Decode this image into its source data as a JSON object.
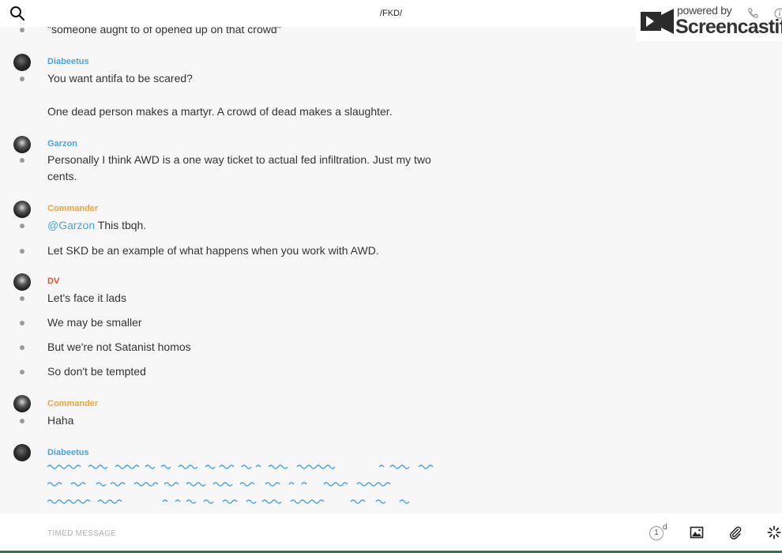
{
  "header": {
    "channel_title": "/FKD/"
  },
  "watermark": {
    "powered_by": "powered by",
    "brand": "Screencastify"
  },
  "messages": {
    "m0": {
      "text": "\"someone aught to of opened up on that crowd\""
    },
    "m1": {
      "user": "Diabeetus",
      "lines": [
        "You want antifa to be scared?",
        "One dead person makes a martyr. A crowd of dead makes a slaughter."
      ]
    },
    "m2": {
      "user": "Garzon",
      "text": "Personally I think AWD is a one way ticket to actual fed infiltration. Just my two cents."
    },
    "m3": {
      "user": "Commander",
      "mention": "@Garzon",
      "after_mention": " This tbqh.",
      "line2": "Let SKD be an example of what happens when you work with AWD."
    },
    "m4": {
      "user": "DV",
      "lines": [
        "Let's face it lads",
        "We may be smaller",
        "But we're not Satanist homos",
        "So don't be tempted"
      ]
    },
    "m5": {
      "user": "Commander",
      "text": "Haha"
    },
    "m6": {
      "user": "Diabeetus"
    }
  },
  "footer": {
    "input_placeholder": "TIMED MESSAGE",
    "timer_value": "1",
    "timer_unit": "d"
  },
  "colors": {
    "username_blue": "#4aa3df",
    "username_orange": "#f0a33a",
    "username_red": "#e0533a",
    "bullet": "#9a9a9a"
  },
  "icons": {
    "search": "search-icon",
    "timer": "timer-icon",
    "image": "image-icon",
    "attach": "paperclip-icon",
    "loading": "spinner-icon"
  }
}
